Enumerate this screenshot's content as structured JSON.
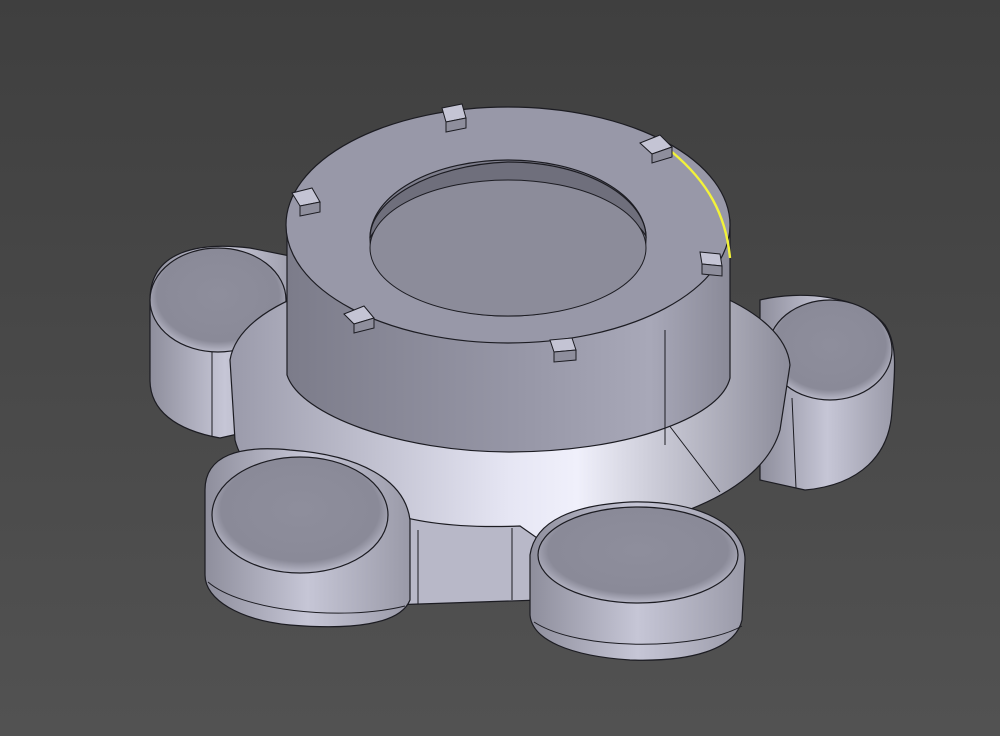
{
  "viewport": {
    "background_top": "#3f3f3f",
    "background_bottom": "#525252",
    "model": {
      "name": "star-knob",
      "lobe_count": 5,
      "locating_tab_count": 6,
      "highlighted_edge_color": "#f2f23a",
      "edge_color": "#1c1c22",
      "face_light": "#dcdcec",
      "face_mid": "#a6a6b6",
      "face_dark": "#71717e"
    }
  }
}
